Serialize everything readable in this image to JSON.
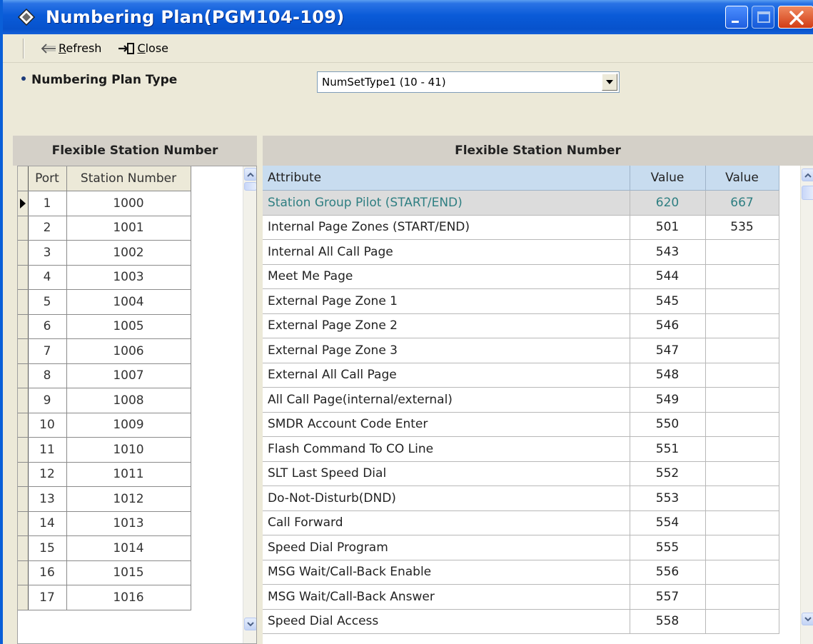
{
  "window": {
    "title": "Numbering Plan(PGM104-109)"
  },
  "toolbar": {
    "refresh_label": "Refresh",
    "close_label": "Close"
  },
  "plan": {
    "label": "Numbering Plan Type",
    "selected": "NumSetType1 (10 - 41)"
  },
  "left_panel": {
    "title": "Flexible Station Number",
    "columns": [
      "Port",
      "Station Number"
    ],
    "rows": [
      [
        "1",
        "1000"
      ],
      [
        "2",
        "1001"
      ],
      [
        "3",
        "1002"
      ],
      [
        "4",
        "1003"
      ],
      [
        "5",
        "1004"
      ],
      [
        "6",
        "1005"
      ],
      [
        "7",
        "1006"
      ],
      [
        "8",
        "1007"
      ],
      [
        "9",
        "1008"
      ],
      [
        "10",
        "1009"
      ],
      [
        "11",
        "1010"
      ],
      [
        "12",
        "1011"
      ],
      [
        "13",
        "1012"
      ],
      [
        "14",
        "1013"
      ],
      [
        "15",
        "1014"
      ],
      [
        "16",
        "1015"
      ],
      [
        "17",
        "1016"
      ]
    ]
  },
  "right_panel": {
    "title": "Flexible Station Number",
    "columns": [
      "Attribute",
      "Value",
      "Value"
    ],
    "rows": [
      [
        "Station Group Pilot (START/END)",
        "620",
        "667"
      ],
      [
        "Internal Page Zones (START/END)",
        "501",
        "535"
      ],
      [
        "Internal All Call Page",
        "543",
        ""
      ],
      [
        "Meet Me Page",
        "544",
        ""
      ],
      [
        "External Page Zone 1",
        "545",
        ""
      ],
      [
        "External Page Zone 2",
        "546",
        ""
      ],
      [
        "External Page Zone 3",
        "547",
        ""
      ],
      [
        "External All Call Page",
        "548",
        ""
      ],
      [
        "All Call Page(internal/external)",
        "549",
        ""
      ],
      [
        "SMDR Account Code Enter",
        "550",
        ""
      ],
      [
        "Flash Command To CO Line",
        "551",
        ""
      ],
      [
        "SLT Last Speed Dial",
        "552",
        ""
      ],
      [
        "Do-Not-Disturb(DND)",
        "553",
        ""
      ],
      [
        "Call Forward",
        "554",
        ""
      ],
      [
        "Speed Dial Program",
        "555",
        ""
      ],
      [
        "MSG Wait/Call-Back Enable",
        "556",
        ""
      ],
      [
        "MSG Wait/Call-Back Answer",
        "557",
        ""
      ],
      [
        "Speed Dial Access",
        "558",
        ""
      ]
    ]
  },
  "colors": {
    "titlebar": "#0a5bd8",
    "highlight_text": "#2f7f82",
    "header_bg": "#c8dcef",
    "window_bg": "#ece9d8"
  }
}
